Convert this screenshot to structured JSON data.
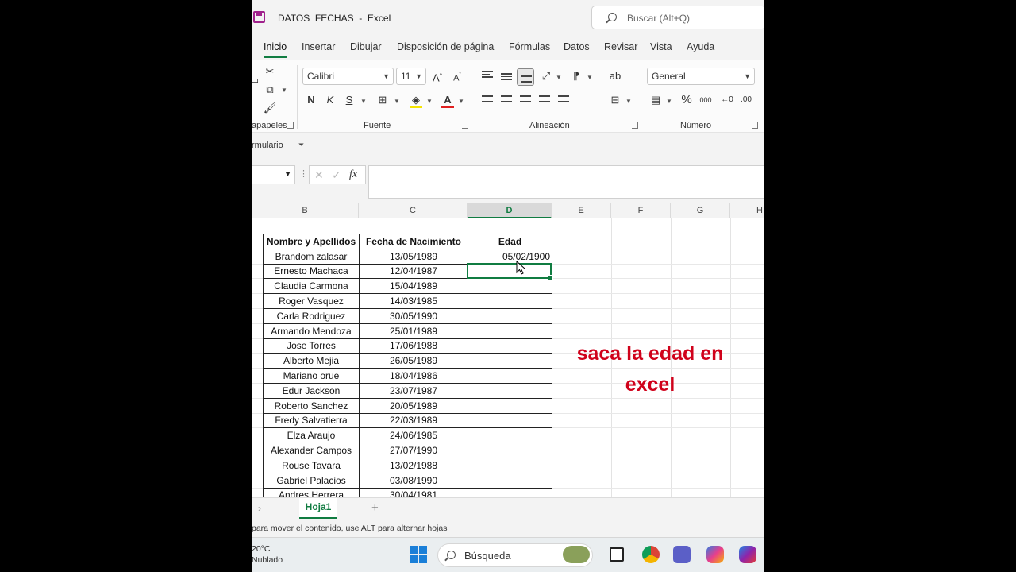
{
  "titlebar": {
    "title": "DATOS  FECHAS  -  Excel",
    "search_placeholder": "Buscar (Alt+Q)"
  },
  "tabs": [
    "Inicio",
    "Insertar",
    "Dibujar",
    "Disposición de página",
    "Fórmulas",
    "Datos",
    "Revisar",
    "Vista",
    "Ayuda"
  ],
  "active_tab": "Inicio",
  "ribbon": {
    "font_name": "Calibri",
    "font_size": "11",
    "number_format": "General",
    "groups": {
      "clipboard": "apapeles",
      "font": "Fuente",
      "alignment": "Alineación",
      "number": "Número"
    },
    "bold": "N",
    "italic": "K",
    "underline": "S",
    "percent": "%",
    "thousands": "000"
  },
  "qat": {
    "label": "rmulario"
  },
  "formula_bar": {
    "fx": "fx",
    "content": ""
  },
  "columns": [
    "B",
    "C",
    "D",
    "E",
    "F",
    "G",
    "H"
  ],
  "active_column": "D",
  "table": {
    "headers": [
      "Nombre y Apellidos",
      "Fecha de Nacimiento",
      "Edad"
    ],
    "rows": [
      [
        "Brandom zalasar",
        "13/05/1989",
        "05/02/1900"
      ],
      [
        "Ernesto Machaca",
        "12/04/1987",
        ""
      ],
      [
        "Claudia Carmona",
        "15/04/1989",
        ""
      ],
      [
        "Roger Vasquez",
        "14/03/1985",
        ""
      ],
      [
        "Carla Rodriguez",
        "30/05/1990",
        ""
      ],
      [
        "Armando Mendoza",
        "25/01/1989",
        ""
      ],
      [
        "Jose Torres",
        "17/06/1988",
        ""
      ],
      [
        "Alberto Mejia",
        "26/05/1989",
        ""
      ],
      [
        "Mariano  orue",
        "18/04/1986",
        ""
      ],
      [
        "Edur Jackson",
        "23/07/1987",
        ""
      ],
      [
        "Roberto Sanchez",
        "20/05/1989",
        ""
      ],
      [
        "Fredy Salvatierra",
        "22/03/1989",
        ""
      ],
      [
        "Elza Araujo",
        "24/06/1985",
        ""
      ],
      [
        "Alexander Campos",
        "27/07/1990",
        ""
      ],
      [
        "Rouse Tavara",
        "13/02/1988",
        ""
      ],
      [
        "Gabriel Palacios",
        "03/08/1990",
        ""
      ],
      [
        "Andres  Herrera",
        "30/04/1981",
        ""
      ]
    ]
  },
  "overlay": {
    "line1": "saca la edad en",
    "line2": "excel",
    "color": "#d0021b"
  },
  "sheet": {
    "name": "Hoja1",
    "add": "+"
  },
  "status": {
    "text": "para mover el contenido, use ALT para alternar hojas"
  },
  "taskbar": {
    "temperature": "20°C",
    "weather": "Nublado",
    "search": "Búsqueda"
  },
  "colors": {
    "accent": "#107c41"
  }
}
